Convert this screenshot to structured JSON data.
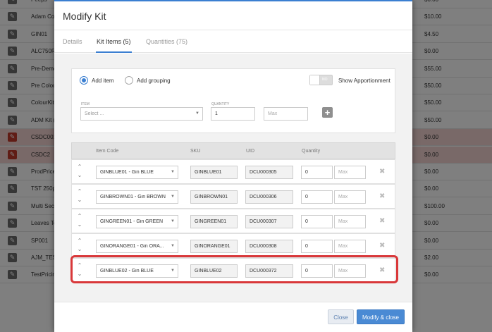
{
  "background": {
    "rows": [
      {
        "name": "Peeps",
        "price": "$0.00",
        "highlight": false
      },
      {
        "name": "Adam Co",
        "price": "$10.00",
        "highlight": false
      },
      {
        "name": "GIN01",
        "price": "$4.50",
        "highlight": false
      },
      {
        "name": "ALC750R",
        "price": "$0.00",
        "highlight": false
      },
      {
        "name": "Pre-Demo",
        "price": "$55.00",
        "highlight": false
      },
      {
        "name": "Pre Colou",
        "price": "$50.00",
        "highlight": false
      },
      {
        "name": "ColourKit",
        "price": "$50.00",
        "highlight": false
      },
      {
        "name": "ADM Kit (",
        "price": "$50.00",
        "highlight": false
      },
      {
        "name": "CSDC001",
        "price": "$0.00",
        "highlight": true
      },
      {
        "name": "CSDC2",
        "price": "$0.00",
        "highlight": true
      },
      {
        "name": "ProdPrice",
        "price": "$0.00",
        "highlight": false
      },
      {
        "name": "TST 250p",
        "price": "$0.00",
        "highlight": false
      },
      {
        "name": "Multi Sect",
        "price": "$100.00",
        "highlight": false
      },
      {
        "name": "Leaves Te",
        "price": "$0.00",
        "highlight": false
      },
      {
        "name": "SP001",
        "price": "$0.00",
        "highlight": false
      },
      {
        "name": "AJM_TES",
        "price": "$2.00",
        "highlight": false
      },
      {
        "name": "TestPricin",
        "price": "$0.00",
        "highlight": false
      }
    ]
  },
  "modal": {
    "title": "Modify Kit",
    "tabs": [
      {
        "label": "Details",
        "active": false
      },
      {
        "label": "Kit Items (5)",
        "active": true
      },
      {
        "label": "Quantities (75)",
        "active": false
      }
    ],
    "add_panel": {
      "radio_add_item": "Add item",
      "radio_add_grouping": "Add grouping",
      "toggle_state": "NO",
      "toggle_label": "Show Apportionment",
      "item_label": "ITEM",
      "item_placeholder": "Select ...",
      "quantity_label": "QUANTITY",
      "quantity_value": "1",
      "max_placeholder": "Max"
    },
    "table": {
      "headers": {
        "item_code": "Item Code",
        "sku": "SKU",
        "uid": "UID",
        "quantity": "Quantity"
      },
      "rows": [
        {
          "item": "GINBLUE01 - Gin BLUE",
          "sku": "GINBLUE01",
          "uid": "DCU000305",
          "qty": "0",
          "max": "Max"
        },
        {
          "item": "GINBROWN01 - Gin BROWN",
          "sku": "GINBROWN01",
          "uid": "DCU000306",
          "qty": "0",
          "max": "Max"
        },
        {
          "item": "GINGREEN01 - Gin GREEN",
          "sku": "GINGREEN01",
          "uid": "DCU000307",
          "qty": "0",
          "max": "Max"
        },
        {
          "item": "GINORANGE01 - Gin ORA...",
          "sku": "GINORANGE01",
          "uid": "DCU000308",
          "qty": "0",
          "max": "Max"
        },
        {
          "item": "GINBLUE02 - Gin BLUE",
          "sku": "GINBLUE02",
          "uid": "DCU000372",
          "qty": "0",
          "max": "Max"
        }
      ]
    },
    "footer": {
      "close_label": "Close",
      "primary_label": "Modify & close"
    }
  },
  "colors": {
    "accent": "#3b7fd1",
    "highlight_outline": "#d9383a",
    "error_row": "#f2d3d0"
  },
  "icons": {
    "edit": "pencil-icon",
    "add": "plus-icon",
    "remove": "close-icon",
    "reorder": "chevron-up-down-icon",
    "dropdown": "caret-down-icon"
  }
}
